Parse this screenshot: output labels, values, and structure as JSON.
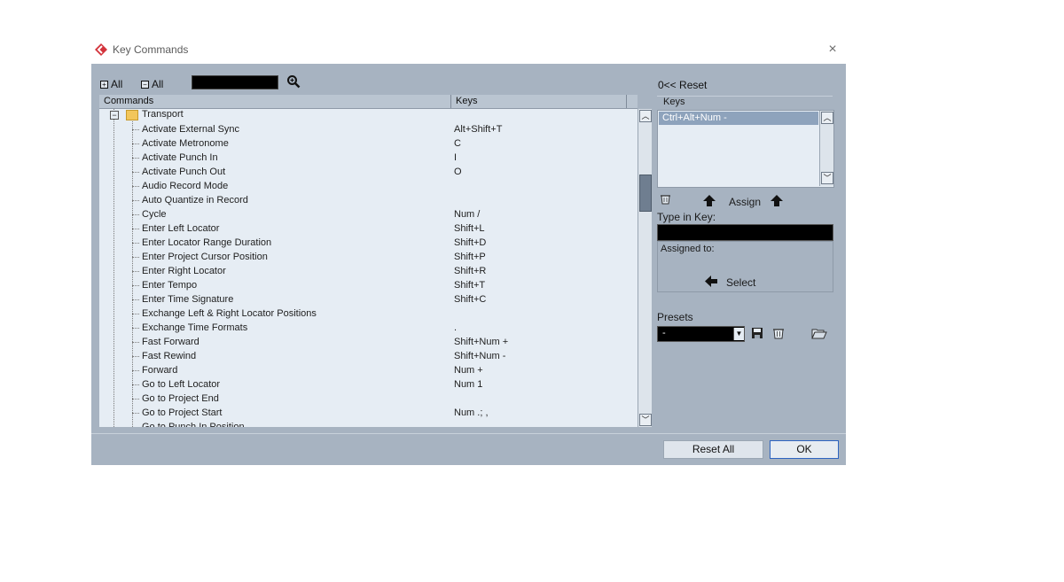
{
  "window": {
    "title": "Key Commands",
    "close_label": "×"
  },
  "toolbar": {
    "expand_all": "All",
    "collapse_all": "All",
    "expand_sym": "+",
    "collapse_sym": "−"
  },
  "commands": {
    "header_commands": "Commands",
    "header_keys": "Keys",
    "folder": "Transport",
    "rows": [
      {
        "cmd": "Activate External Sync",
        "key": "Alt+Shift+T"
      },
      {
        "cmd": "Activate Metronome",
        "key": "C"
      },
      {
        "cmd": "Activate Punch In",
        "key": "I"
      },
      {
        "cmd": "Activate Punch Out",
        "key": "O"
      },
      {
        "cmd": "Audio Record Mode",
        "key": ""
      },
      {
        "cmd": "Auto Quantize in Record",
        "key": ""
      },
      {
        "cmd": "Cycle",
        "key": "Num /"
      },
      {
        "cmd": "Enter Left Locator",
        "key": "Shift+L"
      },
      {
        "cmd": "Enter Locator Range Duration",
        "key": "Shift+D"
      },
      {
        "cmd": "Enter Project Cursor Position",
        "key": "Shift+P"
      },
      {
        "cmd": "Enter Right Locator",
        "key": "Shift+R"
      },
      {
        "cmd": "Enter Tempo",
        "key": "Shift+T"
      },
      {
        "cmd": "Enter Time Signature",
        "key": "Shift+C"
      },
      {
        "cmd": "Exchange Left & Right Locator Positions",
        "key": ""
      },
      {
        "cmd": "Exchange Time Formats",
        "key": "."
      },
      {
        "cmd": "Fast Forward",
        "key": "Shift+Num +"
      },
      {
        "cmd": "Fast Rewind",
        "key": "Shift+Num -"
      },
      {
        "cmd": "Forward",
        "key": "Num +"
      },
      {
        "cmd": "Go to Left Locator",
        "key": "Num 1"
      },
      {
        "cmd": "Go to Project End",
        "key": ""
      },
      {
        "cmd": "Go to Project Start",
        "key": "Num .; ,"
      },
      {
        "cmd": "Go to Punch In Position",
        "key": ""
      }
    ]
  },
  "right": {
    "reset": "0<< Reset",
    "keys_label": "Keys",
    "selected_key": "Ctrl+Alt+Num -",
    "assign": "Assign",
    "type_in_key": "Type in Key:",
    "assigned_to": "Assigned to:",
    "select": "Select",
    "presets_label": "Presets",
    "preset_value": "-"
  },
  "buttons": {
    "reset_all": "Reset All",
    "ok": "OK"
  },
  "colors": {
    "panel": "#a7b3c1",
    "list_bg": "#e6edf4",
    "accent": "#2e64c0",
    "logo": "#d3343c"
  }
}
